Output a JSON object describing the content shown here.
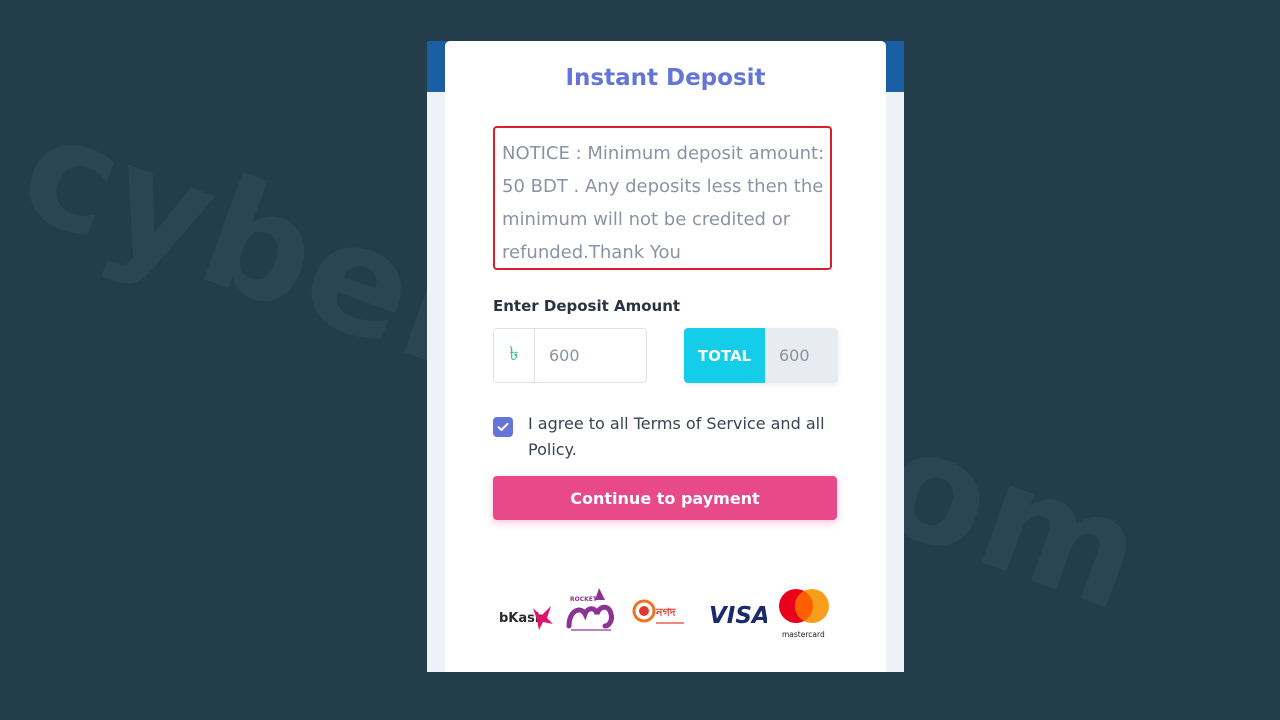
{
  "watermark": "cybersaz.com",
  "card": {
    "title": "Instant Deposit",
    "notice": "NOTICE : Minimum deposit amount: 50 BDT . Any deposits less then the minimum will not be credited or refunded.Thank You",
    "amount_label": "Enter Deposit Amount",
    "currency_symbol": "৳",
    "amount_value": "600",
    "total_label": "TOTAL",
    "total_value": "600",
    "agree_checked": true,
    "agree_text": "I agree to all Terms of Service and all Policy.",
    "pay_button": "Continue to payment"
  },
  "payment_methods": [
    {
      "name": "bKash",
      "icon": "bkash-logo-icon"
    },
    {
      "name": "ROCKET",
      "icon": "rocket-logo-icon"
    },
    {
      "name": "নগদ",
      "icon": "nagad-logo-icon"
    },
    {
      "name": "VISA",
      "icon": "visa-logo-icon"
    },
    {
      "name": "mastercard",
      "icon": "mastercard-logo-icon"
    }
  ],
  "colors": {
    "background": "#233d4b",
    "accent": "#6474d8",
    "notice_border": "#d91f2a",
    "total": "#14cde8",
    "button": "#e84a89"
  }
}
